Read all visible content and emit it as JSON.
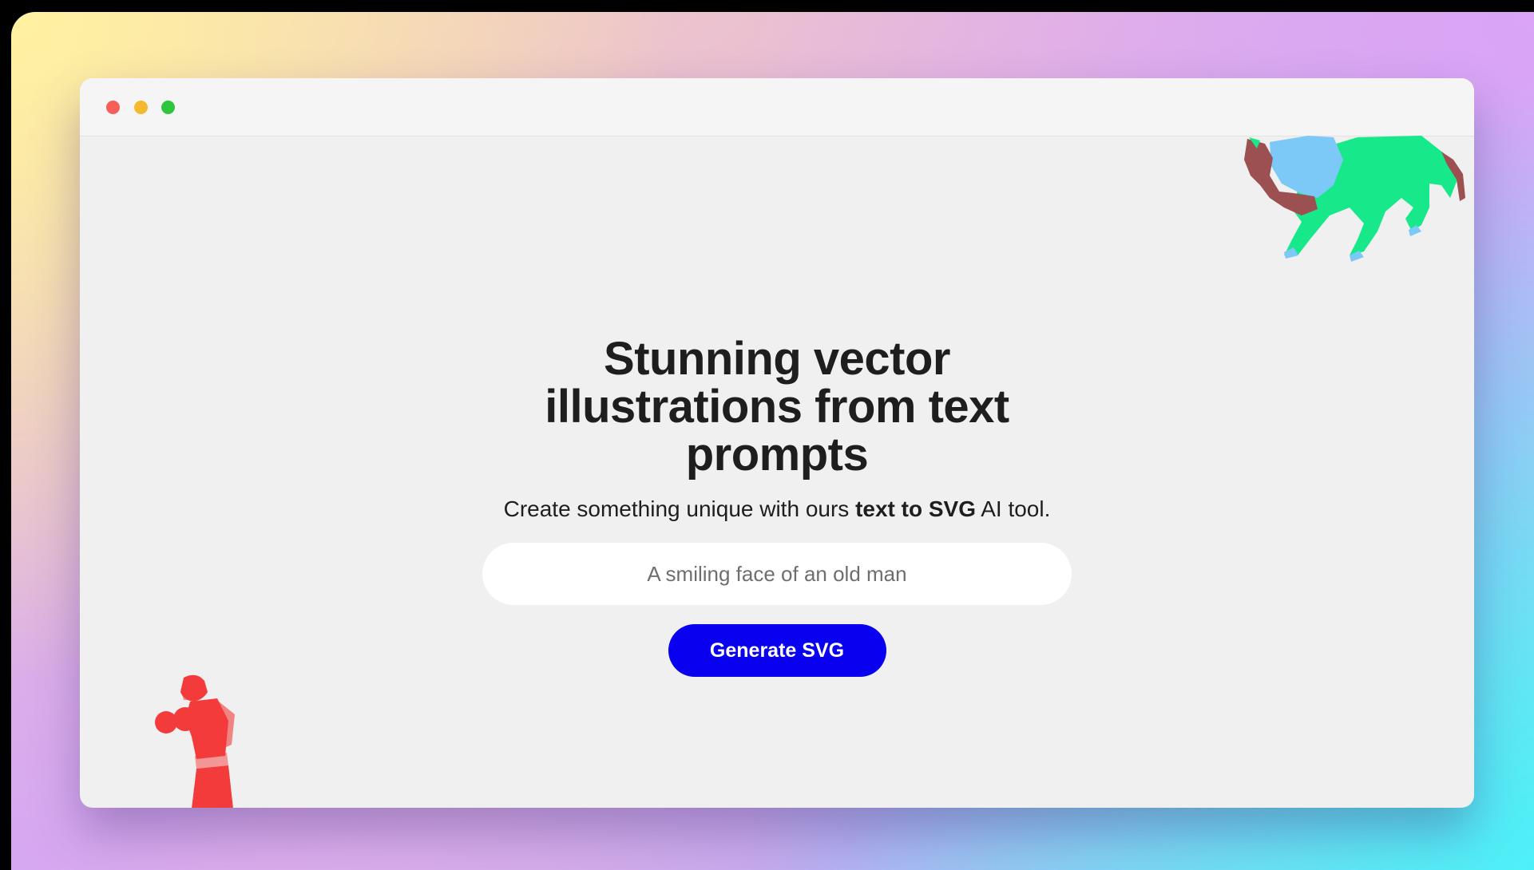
{
  "window": {
    "controls": [
      {
        "name": "close",
        "color": "#f55f57"
      },
      {
        "name": "minimize",
        "color": "#f6b82e"
      },
      {
        "name": "maximize",
        "color": "#2fc53f"
      }
    ]
  },
  "hero": {
    "headline": "Stunning vector illustrations from text prompts",
    "subtitle_prefix": "Create something unique with ours ",
    "subtitle_bold": "text to SVG",
    "subtitle_suffix": " AI tool.",
    "input_placeholder": "A smiling face of an old man",
    "button_label": "Generate SVG"
  },
  "colors": {
    "accent": "#0a00f0",
    "headline": "#1e1e1e",
    "lion_green": "#17e88a",
    "lion_blue": "#7cc9f8",
    "lion_brown": "#9c5052",
    "boxer_red": "#f43b3b"
  },
  "illustrations": {
    "top_right": "lion-illustration",
    "bottom_left": "boxer-illustration"
  }
}
